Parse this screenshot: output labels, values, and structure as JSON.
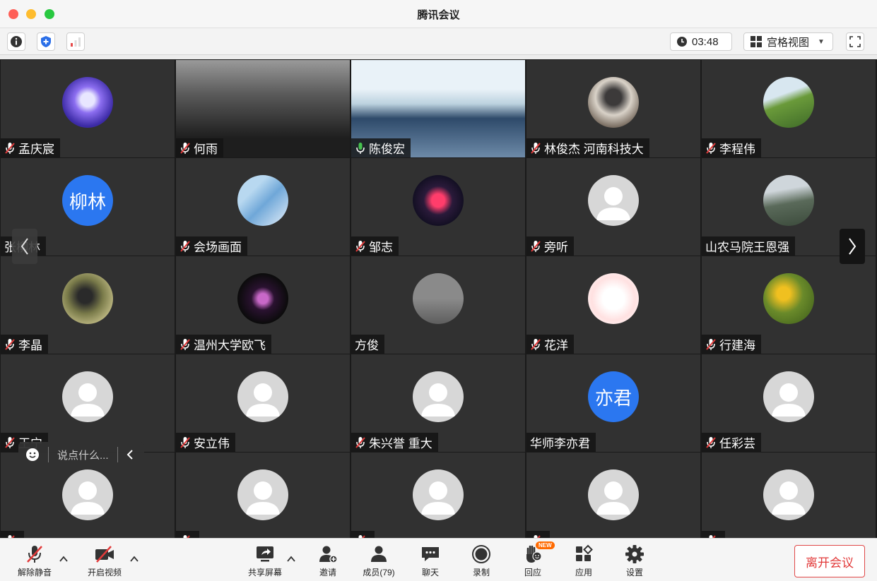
{
  "window": {
    "title": "腾讯会议"
  },
  "toolbar": {
    "timer": "03:48",
    "view_mode": "宫格视图"
  },
  "chat": {
    "placeholder": "说点什么..."
  },
  "tiles": [
    {
      "name": "孟庆宸",
      "muted": true,
      "avatar": "image"
    },
    {
      "name": "何雨",
      "muted": true,
      "avatar": "video"
    },
    {
      "name": "陈俊宏",
      "muted": false,
      "speaking": true,
      "avatar": "video"
    },
    {
      "name": "林俊杰 河南科技大",
      "muted": true,
      "avatar": "image"
    },
    {
      "name": "李程伟",
      "muted": true,
      "avatar": "image"
    },
    {
      "name": "张柳林",
      "muted": null,
      "avatar": "text",
      "avatar_text": "柳林"
    },
    {
      "name": "会场画面",
      "muted": true,
      "avatar": "image"
    },
    {
      "name": "邹志",
      "muted": true,
      "avatar": "image"
    },
    {
      "name": "旁听",
      "muted": true,
      "avatar": "default"
    },
    {
      "name": "山农马院王恩强",
      "muted": null,
      "avatar": "image"
    },
    {
      "name": "李晶",
      "muted": true,
      "avatar": "image"
    },
    {
      "name": "温州大学欧飞",
      "muted": true,
      "avatar": "image"
    },
    {
      "name": "方俊",
      "muted": null,
      "avatar": "image"
    },
    {
      "name": "花洋",
      "muted": true,
      "avatar": "image"
    },
    {
      "name": "行建海",
      "muted": true,
      "avatar": "image"
    },
    {
      "name": "王宁",
      "muted": true,
      "avatar": "default"
    },
    {
      "name": "安立伟",
      "muted": true,
      "avatar": "default"
    },
    {
      "name": "朱兴誉 重大",
      "muted": true,
      "avatar": "default"
    },
    {
      "name": "华师李亦君",
      "muted": null,
      "avatar": "text",
      "avatar_text": "亦君"
    },
    {
      "name": "任彩芸",
      "muted": true,
      "avatar": "default"
    },
    {
      "name": "",
      "muted": true,
      "avatar": "default"
    },
    {
      "name": "",
      "muted": true,
      "avatar": "default"
    },
    {
      "name": "",
      "muted": true,
      "avatar": "default"
    },
    {
      "name": "",
      "muted": true,
      "avatar": "default"
    },
    {
      "name": "",
      "muted": true,
      "avatar": "default"
    }
  ],
  "controls": {
    "unmute": "解除静音",
    "start_video": "开启视频",
    "share_screen": "共享屏幕",
    "invite": "邀请",
    "members": "成员(79)",
    "chat": "聊天",
    "record": "录制",
    "reactions": "回应",
    "reactions_badge": "NEW",
    "apps": "应用",
    "settings": "设置",
    "leave": "离开会议"
  },
  "colors": {
    "leave": "#e23a3a",
    "active_speaker": "#3fb04a",
    "avatar_blue": "#2b77f0"
  }
}
